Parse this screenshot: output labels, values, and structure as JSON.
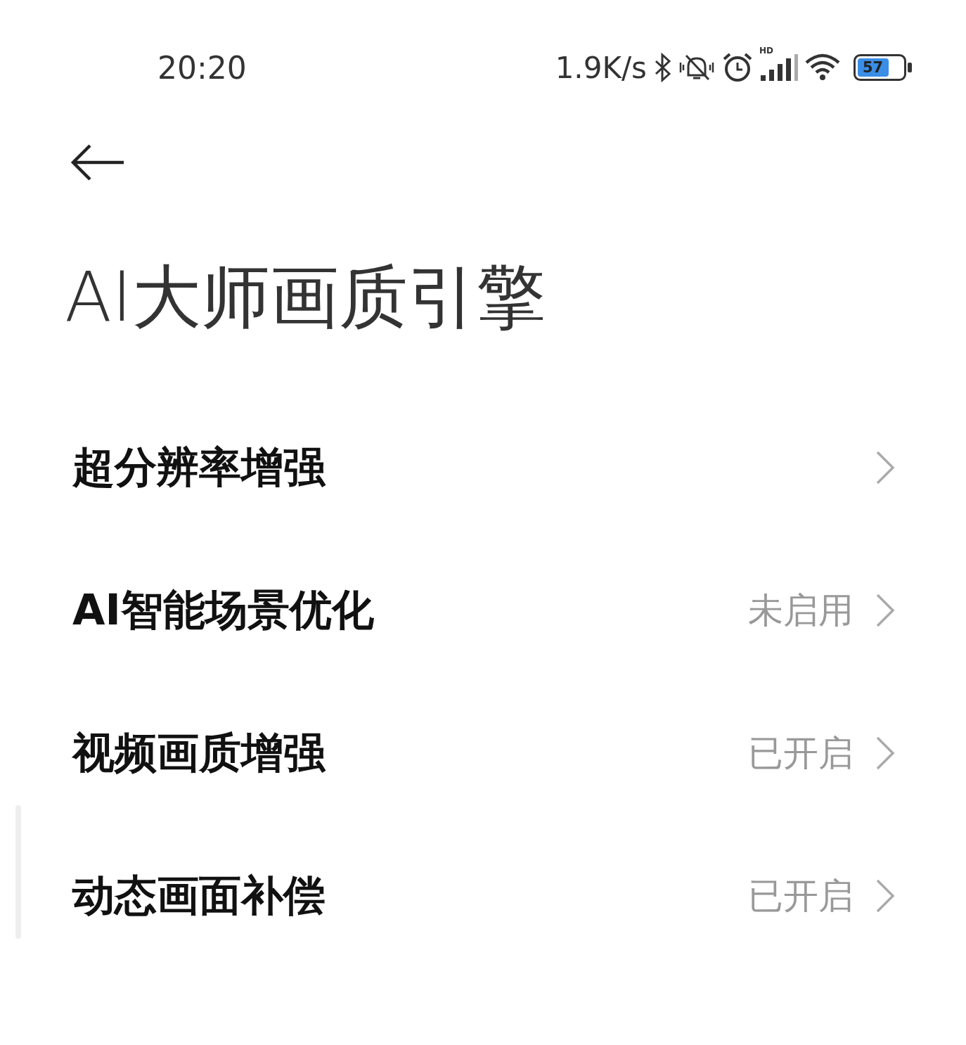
{
  "status_bar": {
    "time": "20:20",
    "network_speed": "1.9K/s",
    "signal_label": "HD",
    "battery": "57"
  },
  "title": "AI大师画质引擎",
  "items": [
    {
      "label": "超分辨率增强"
    },
    {
      "label": "AI智能场景优化",
      "value": "未启用"
    },
    {
      "label": "视频画质增强",
      "value": "已开启"
    },
    {
      "label": "动态画面补偿",
      "value": "已开启"
    }
  ]
}
